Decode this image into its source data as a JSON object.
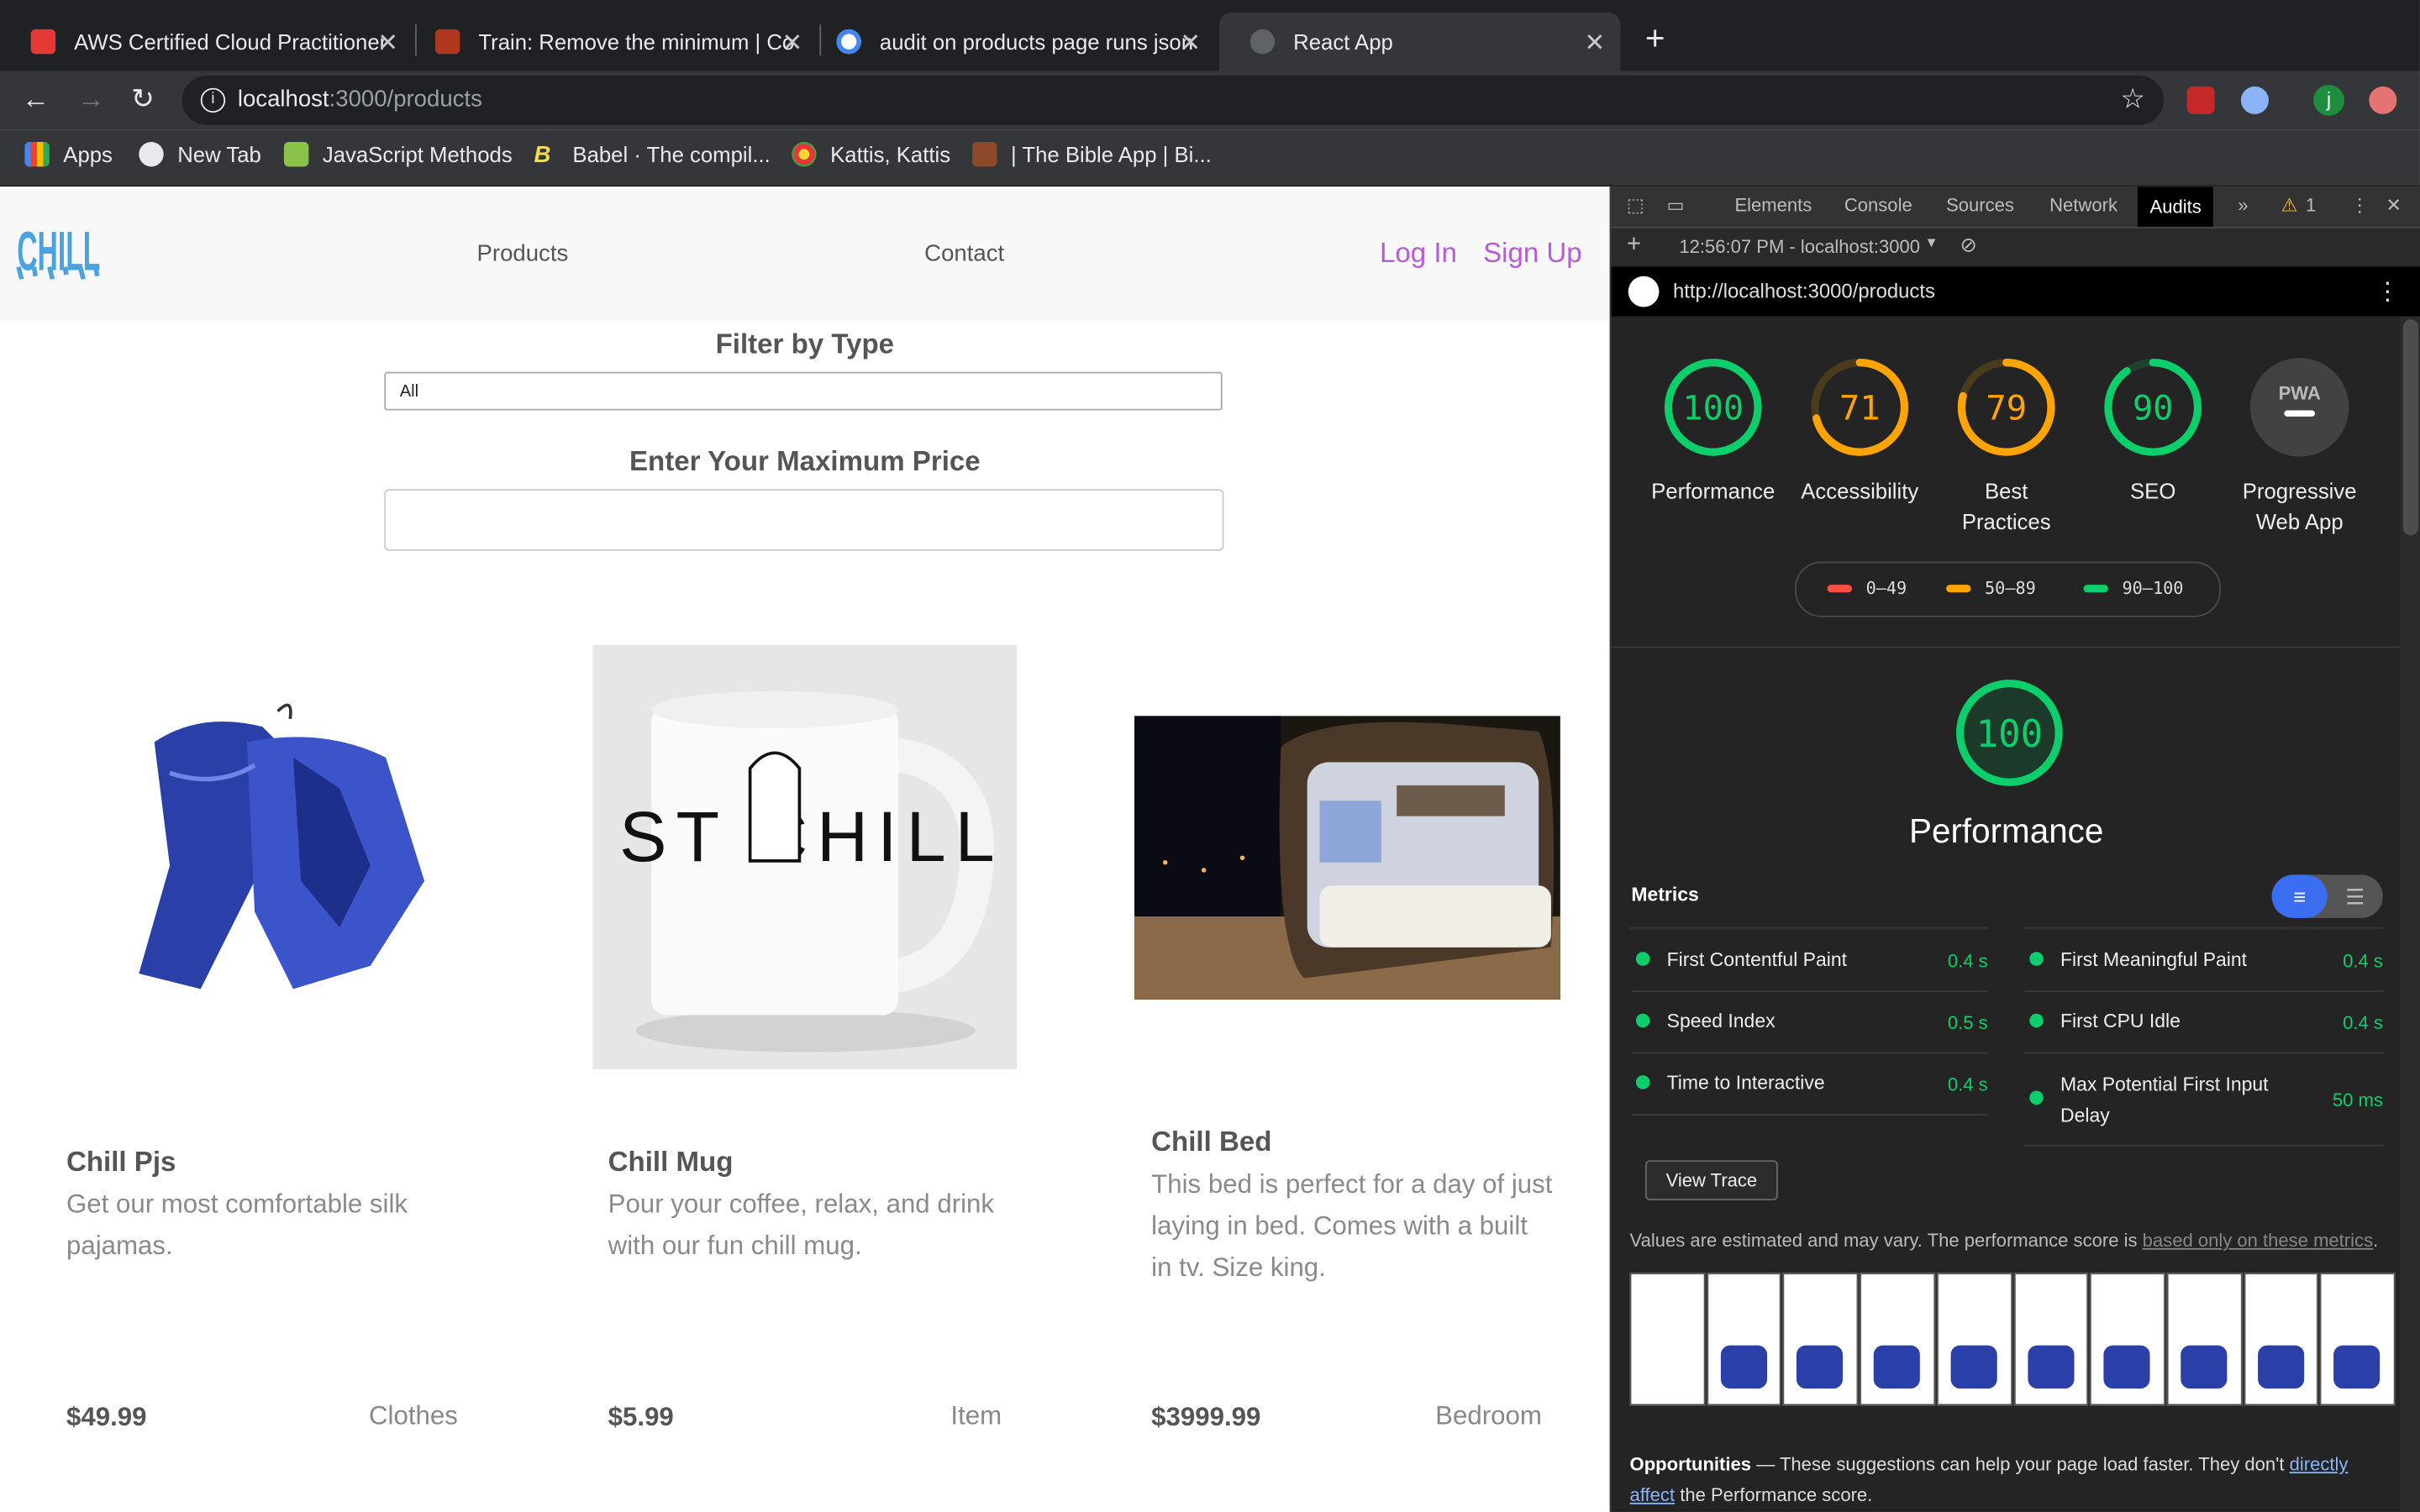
{
  "tabs": [
    {
      "title": "AWS Certified Cloud Practitioner",
      "icon": "aws-icon"
    },
    {
      "title": "Train: Remove the minimum | Co",
      "icon": "codewars-icon"
    },
    {
      "title": "audit on products page runs json",
      "icon": "google-icon"
    },
    {
      "title": "React App",
      "icon": "globe-icon"
    }
  ],
  "address": {
    "host": "localhost",
    "path": ":3000/products"
  },
  "bookmarks": [
    "Apps",
    "New Tab",
    "JavaScript Methods",
    "Babel · The compil...",
    "Kattis, Kattis",
    "| The Bible App | Bi..."
  ],
  "site": {
    "logo_text": "CHILL",
    "nav": {
      "products": "Products",
      "contact": "Contact",
      "login": "Log In",
      "signup": "Sign Up"
    },
    "filter_title": "Filter by Type",
    "filter_value": "All",
    "price_title": "Enter Your Maximum Price",
    "products": [
      {
        "name": "Chill Pjs",
        "desc": "Get our most comfortable silk pajamas.",
        "price": "$49.99",
        "type": "Clothes"
      },
      {
        "name": "Chill Mug",
        "desc": "Pour your coffee, relax, and drink with our fun chill mug.",
        "price": "$5.99",
        "type": "Item"
      },
      {
        "name": "Chill Bed",
        "desc": "This bed is perfect for a day of just laying in bed. Comes with a built in tv. Size king.",
        "price": "$3999.99",
        "type": "Bedroom"
      }
    ],
    "mug_text": "J ST CHILL"
  },
  "devtools": {
    "tabs": [
      "Elements",
      "Console",
      "Sources",
      "Network",
      "Audits"
    ],
    "warnings": "1",
    "report_time": "12:56:07 PM - localhost:3000",
    "report_url": "http://localhost:3000/products",
    "scores": [
      {
        "label": "Performance",
        "value": "100",
        "color": "#0cce6b",
        "fill": 1.0
      },
      {
        "label": "Accessibility",
        "value": "71",
        "color": "#ffa400",
        "fill": 0.71
      },
      {
        "label": "Best Practices",
        "value": "79",
        "color": "#ffa400",
        "fill": 0.79
      },
      {
        "label": "SEO",
        "value": "90",
        "color": "#0cce6b",
        "fill": 0.9
      },
      {
        "label": "Progressive Web App",
        "value": "PWA",
        "color": "#ffffff"
      }
    ],
    "legend": [
      "0–49",
      "50–89",
      "90–100"
    ],
    "legend_colors": [
      "#ff4e42",
      "#ffa400",
      "#0cce6b"
    ],
    "perf_score": "100",
    "perf_title": "Performance",
    "metrics_title": "Metrics",
    "metrics_left": [
      {
        "name": "First Contentful Paint",
        "value": "0.4 s"
      },
      {
        "name": "Speed Index",
        "value": "0.5 s"
      },
      {
        "name": "Time to Interactive",
        "value": "0.4 s"
      }
    ],
    "metrics_right": [
      {
        "name": "First Meaningful Paint",
        "value": "0.4 s"
      },
      {
        "name": "First CPU Idle",
        "value": "0.4 s"
      },
      {
        "name": "Max Potential First Input Delay",
        "value": "50 ms"
      }
    ],
    "view_trace": "View Trace",
    "note_text": "Values are estimated and may vary. The performance score is",
    "note_link": "based only on these metrics",
    "opps_title": "Opportunities",
    "opps_text": "— These suggestions can help your page load faster. They don't",
    "opps_link": "directly affect",
    "opps_tail": "the Performance score."
  }
}
